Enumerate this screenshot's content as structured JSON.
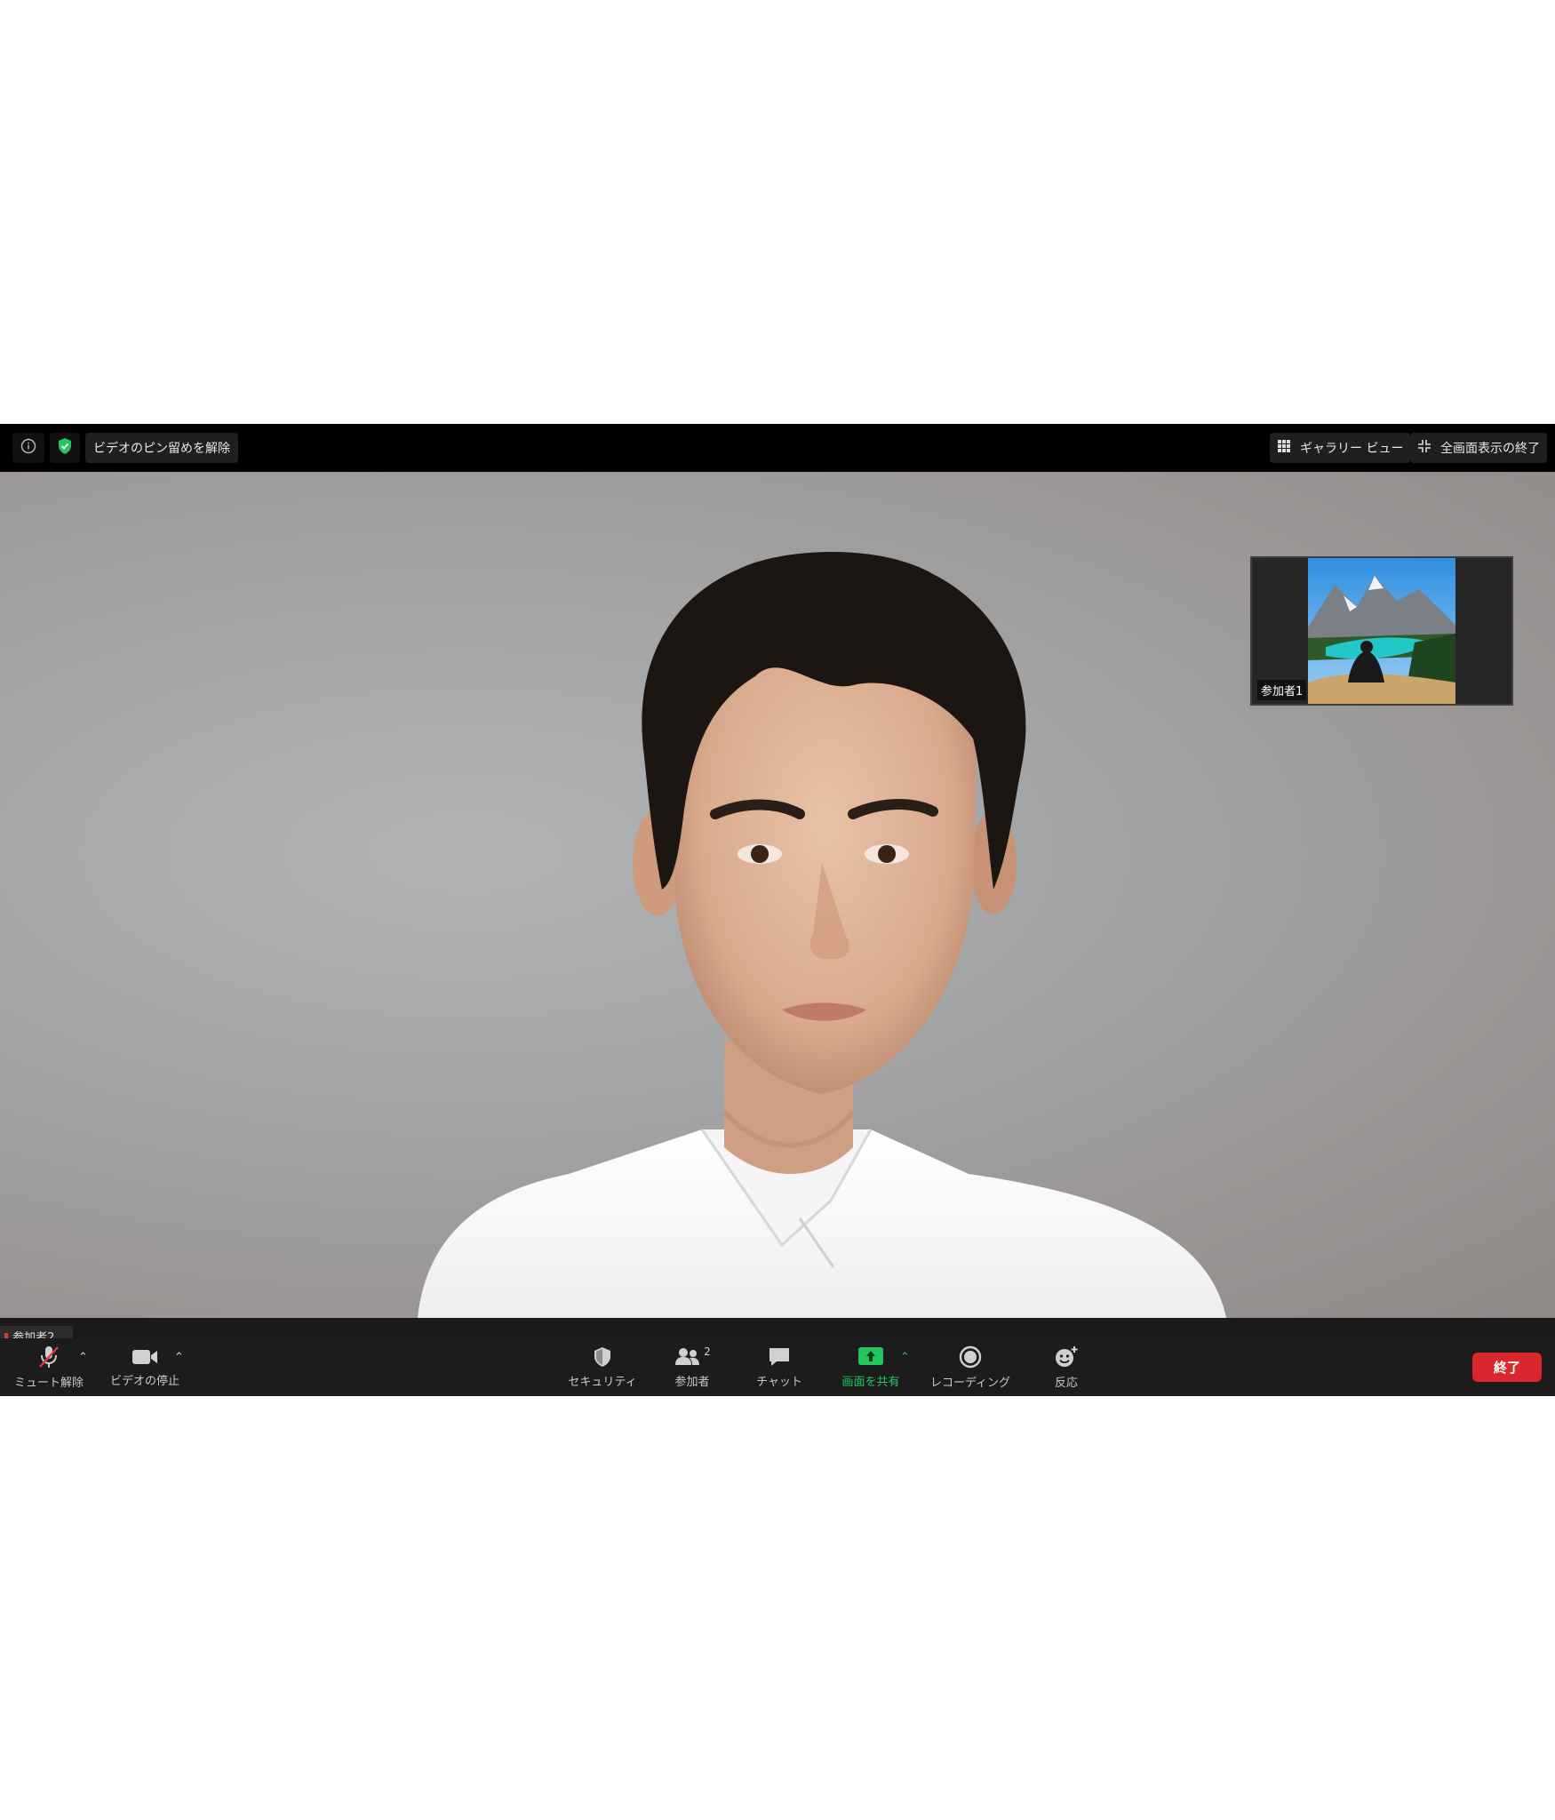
{
  "topbar": {
    "unpin_label": "ビデオのピン留めを解除",
    "gallery_label": "ギャラリー ビュー",
    "exit_fullscreen_label": "全画面表示の終了"
  },
  "thumbnail": {
    "participant_name": "参加者1"
  },
  "main": {
    "participant_name": "参加者2"
  },
  "toolbar": {
    "mute_label": "ミュート解除",
    "video_label": "ビデオの停止",
    "security_label": "セキュリティ",
    "participants_label": "参加者",
    "participants_count": "2",
    "chat_label": "チャット",
    "share_label": "画面を共有",
    "record_label": "レコーディング",
    "reactions_label": "反応",
    "end_label": "終了"
  },
  "colors": {
    "share_green": "#22c55e",
    "end_red": "#d9272e",
    "shield_green": "#22c55e"
  }
}
